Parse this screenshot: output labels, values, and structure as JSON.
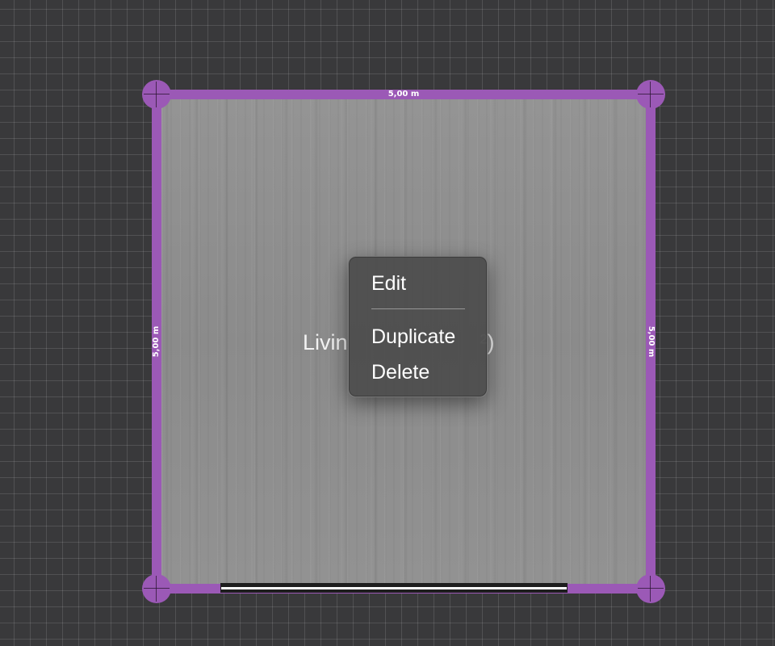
{
  "room": {
    "label": "Livin",
    "label_suffix": "²)",
    "dimensions": {
      "top": "5,00 m",
      "left": "5,00 m",
      "right": "5,00 m"
    },
    "wall_color": "#9b59b6"
  },
  "context_menu": {
    "items": [
      {
        "label": "Edit"
      },
      {
        "label": "Duplicate"
      },
      {
        "label": "Delete"
      }
    ]
  }
}
